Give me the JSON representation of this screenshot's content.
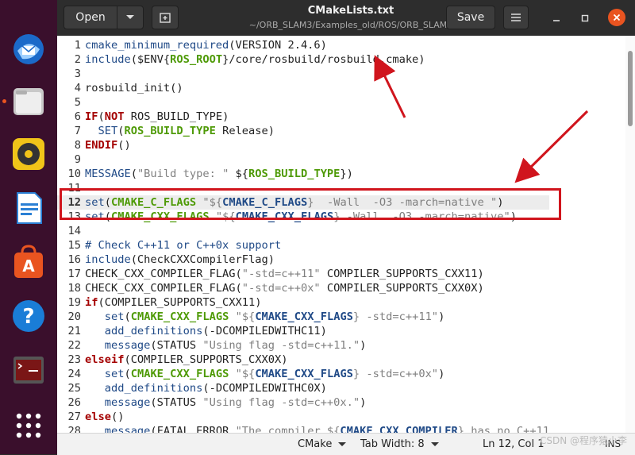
{
  "window": {
    "title": "CMakeLists.txt",
    "subtitle": "~/ORB_SLAM3/Examples_old/ROS/ORB_SLAM3",
    "open_label": "Open",
    "save_label": "Save"
  },
  "dock": {
    "items": [
      {
        "name": "thunderbird-icon"
      },
      {
        "name": "files-icon"
      },
      {
        "name": "rhythmbox-icon"
      },
      {
        "name": "libreoffice-writer-icon"
      },
      {
        "name": "software-center-icon"
      },
      {
        "name": "help-icon"
      },
      {
        "name": "terminal-icon"
      },
      {
        "name": "show-apps-icon"
      }
    ]
  },
  "code": {
    "lines": [
      {
        "n": "1",
        "t": [
          [
            "fn",
            "cmake_minimum_required"
          ],
          [
            "p",
            "(VERSION 2.4.6)"
          ]
        ]
      },
      {
        "n": "2",
        "t": [
          [
            "fn",
            "include"
          ],
          [
            "p",
            "($ENV{"
          ],
          [
            "var",
            "ROS_ROOT"
          ],
          [
            "p",
            "}/core/rosbuild/rosbuild.cmake)"
          ]
        ]
      },
      {
        "n": "3",
        "t": []
      },
      {
        "n": "4",
        "t": [
          [
            "p",
            "rosbuild_init()"
          ]
        ]
      },
      {
        "n": "5",
        "t": []
      },
      {
        "n": "6",
        "t": [
          [
            "kw",
            "IF"
          ],
          [
            "p",
            "("
          ],
          [
            "kw",
            "NOT"
          ],
          [
            "p",
            " ROS_BUILD_TYPE)"
          ]
        ]
      },
      {
        "n": "7",
        "t": [
          [
            "p",
            "  "
          ],
          [
            "fn",
            "SET"
          ],
          [
            "p",
            "("
          ],
          [
            "var",
            "ROS_BUILD_TYPE"
          ],
          [
            "p",
            " Release)"
          ]
        ]
      },
      {
        "n": "8",
        "t": [
          [
            "kw",
            "ENDIF"
          ],
          [
            "p",
            "()"
          ]
        ]
      },
      {
        "n": "9",
        "t": []
      },
      {
        "n": "10",
        "t": [
          [
            "fn",
            "MESSAGE"
          ],
          [
            "p",
            "("
          ],
          [
            "str",
            "\"Build type: \""
          ],
          [
            "p",
            " ${"
          ],
          [
            "var",
            "ROS_BUILD_TYPE"
          ],
          [
            "p",
            "})"
          ]
        ]
      },
      {
        "n": "11",
        "t": []
      },
      {
        "n": "12",
        "t": [
          [
            "fn",
            "set"
          ],
          [
            "p",
            "("
          ],
          [
            "var",
            "CMAKE_C_FLAGS"
          ],
          [
            "p",
            " "
          ],
          [
            "str",
            "\"${"
          ],
          [
            "ex",
            "CMAKE_C_FLAGS"
          ],
          [
            "str",
            "}  -Wall  -O3 -march=native \""
          ],
          [
            "p",
            ")"
          ]
        ]
      },
      {
        "n": "13",
        "t": [
          [
            "fn",
            "set"
          ],
          [
            "p",
            "("
          ],
          [
            "var",
            "CMAKE_CXX_FLAGS"
          ],
          [
            "p",
            " "
          ],
          [
            "str",
            "\"${"
          ],
          [
            "ex",
            "CMAKE_CXX_FLAGS"
          ],
          [
            "str",
            "} -Wall  -O3 -march=native\""
          ],
          [
            "p",
            ")"
          ]
        ]
      },
      {
        "n": "14",
        "t": []
      },
      {
        "n": "15",
        "t": [
          [
            "cm",
            "# Check C++11 or C++0x support"
          ]
        ]
      },
      {
        "n": "16",
        "t": [
          [
            "fn",
            "include"
          ],
          [
            "p",
            "(CheckCXXCompilerFlag)"
          ]
        ]
      },
      {
        "n": "17",
        "t": [
          [
            "p",
            "CHECK_CXX_COMPILER_FLAG("
          ],
          [
            "str",
            "\"-std=c++11\""
          ],
          [
            "p",
            " COMPILER_SUPPORTS_CXX11)"
          ]
        ]
      },
      {
        "n": "18",
        "t": [
          [
            "p",
            "CHECK_CXX_COMPILER_FLAG("
          ],
          [
            "str",
            "\"-std=c++0x\""
          ],
          [
            "p",
            " COMPILER_SUPPORTS_CXX0X)"
          ]
        ]
      },
      {
        "n": "19",
        "t": [
          [
            "kw",
            "if"
          ],
          [
            "p",
            "(COMPILER_SUPPORTS_CXX11)"
          ]
        ]
      },
      {
        "n": "20",
        "t": [
          [
            "p",
            "   "
          ],
          [
            "fn",
            "set"
          ],
          [
            "p",
            "("
          ],
          [
            "var",
            "CMAKE_CXX_FLAGS"
          ],
          [
            "p",
            " "
          ],
          [
            "str",
            "\"${"
          ],
          [
            "ex",
            "CMAKE_CXX_FLAGS"
          ],
          [
            "str",
            "} -std=c++11\""
          ],
          [
            "p",
            ")"
          ]
        ]
      },
      {
        "n": "21",
        "t": [
          [
            "p",
            "   "
          ],
          [
            "fn",
            "add_definitions"
          ],
          [
            "p",
            "(-DCOMPILEDWITHC11)"
          ]
        ]
      },
      {
        "n": "22",
        "t": [
          [
            "p",
            "   "
          ],
          [
            "fn",
            "message"
          ],
          [
            "p",
            "(STATUS "
          ],
          [
            "str",
            "\"Using flag -std=c++11.\""
          ],
          [
            "p",
            ")"
          ]
        ]
      },
      {
        "n": "23",
        "t": [
          [
            "kw",
            "elseif"
          ],
          [
            "p",
            "(COMPILER_SUPPORTS_CXX0X)"
          ]
        ]
      },
      {
        "n": "24",
        "t": [
          [
            "p",
            "   "
          ],
          [
            "fn",
            "set"
          ],
          [
            "p",
            "("
          ],
          [
            "var",
            "CMAKE_CXX_FLAGS"
          ],
          [
            "p",
            " "
          ],
          [
            "str",
            "\"${"
          ],
          [
            "ex",
            "CMAKE_CXX_FLAGS"
          ],
          [
            "str",
            "} -std=c++0x\""
          ],
          [
            "p",
            ")"
          ]
        ]
      },
      {
        "n": "25",
        "t": [
          [
            "p",
            "   "
          ],
          [
            "fn",
            "add_definitions"
          ],
          [
            "p",
            "(-DCOMPILEDWITHC0X)"
          ]
        ]
      },
      {
        "n": "26",
        "t": [
          [
            "p",
            "   "
          ],
          [
            "fn",
            "message"
          ],
          [
            "p",
            "(STATUS "
          ],
          [
            "str",
            "\"Using flag -std=c++0x.\""
          ],
          [
            "p",
            ")"
          ]
        ]
      },
      {
        "n": "27",
        "t": [
          [
            "kw",
            "else"
          ],
          [
            "p",
            "()"
          ]
        ]
      },
      {
        "n": "28",
        "t": [
          [
            "p",
            "   "
          ],
          [
            "fn",
            "message"
          ],
          [
            "p",
            "(FATAL_ERROR "
          ],
          [
            "str",
            "\"The compiler ${"
          ],
          [
            "ex",
            "CMAKE_CXX_COMPILER"
          ],
          [
            "str",
            "} has no C++11"
          ]
        ]
      }
    ],
    "current_line": "12"
  },
  "statusbar": {
    "language": "CMake",
    "tab_width": "Tab Width: 8",
    "cursor": "Ln 12, Col 1",
    "mode": "INS"
  },
  "watermark": "CSDN @程序猿小李"
}
